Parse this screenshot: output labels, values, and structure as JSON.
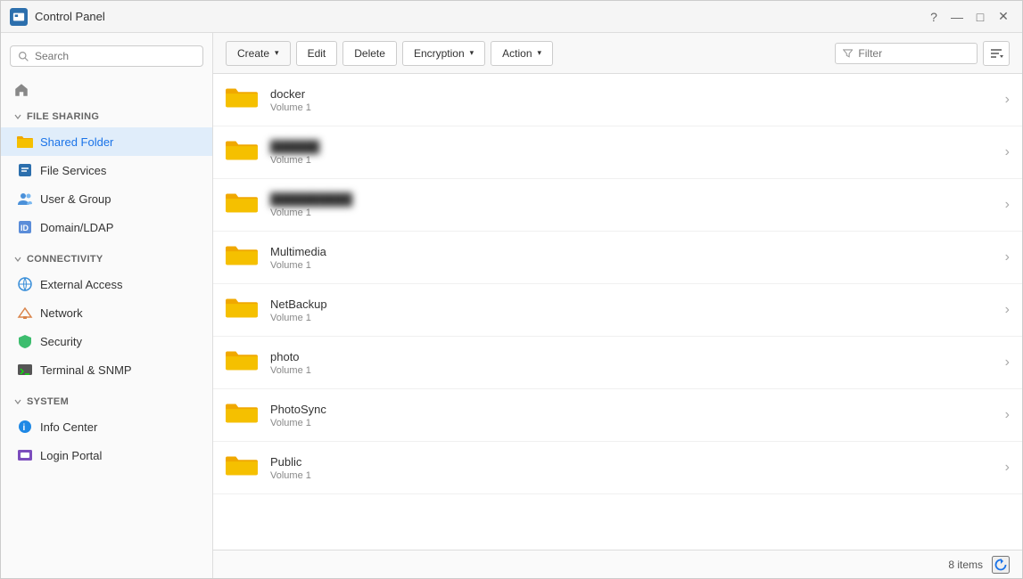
{
  "titlebar": {
    "title": "Control Panel",
    "buttons": [
      "?",
      "—",
      "□",
      "✕"
    ]
  },
  "sidebar": {
    "search_placeholder": "Search",
    "sections": [
      {
        "label": "File Sharing",
        "collapsed": false,
        "items": [
          {
            "id": "shared-folder",
            "label": "Shared Folder",
            "active": true,
            "icon": "folder-orange"
          },
          {
            "id": "file-services",
            "label": "File Services",
            "active": false,
            "icon": "file-services"
          },
          {
            "id": "user-group",
            "label": "User & Group",
            "active": false,
            "icon": "user-group"
          },
          {
            "id": "domain-ldap",
            "label": "Domain/LDAP",
            "active": false,
            "icon": "domain"
          }
        ]
      },
      {
        "label": "Connectivity",
        "collapsed": false,
        "items": [
          {
            "id": "external-access",
            "label": "External Access",
            "active": false,
            "icon": "external-access"
          },
          {
            "id": "network",
            "label": "Network",
            "active": false,
            "icon": "network"
          },
          {
            "id": "security",
            "label": "Security",
            "active": false,
            "icon": "security"
          },
          {
            "id": "terminal-snmp",
            "label": "Terminal & SNMP",
            "active": false,
            "icon": "terminal"
          }
        ]
      },
      {
        "label": "System",
        "collapsed": false,
        "items": [
          {
            "id": "info-center",
            "label": "Info Center",
            "active": false,
            "icon": "info"
          },
          {
            "id": "login-portal",
            "label": "Login Portal",
            "active": false,
            "icon": "login-portal"
          }
        ]
      }
    ]
  },
  "toolbar": {
    "create_label": "Create",
    "edit_label": "Edit",
    "delete_label": "Delete",
    "encryption_label": "Encryption",
    "action_label": "Action",
    "filter_placeholder": "Filter"
  },
  "folders": [
    {
      "name": "docker",
      "sub": "Volume 1",
      "blurred": false
    },
    {
      "name": "██████",
      "sub": "Volume 1",
      "blurred": true
    },
    {
      "name": "██████████",
      "sub": "Volume 1",
      "blurred": true
    },
    {
      "name": "Multimedia",
      "sub": "Volume 1",
      "blurred": false
    },
    {
      "name": "NetBackup",
      "sub": "Volume 1",
      "blurred": false
    },
    {
      "name": "photo",
      "sub": "Volume 1",
      "blurred": false
    },
    {
      "name": "PhotoSync",
      "sub": "Volume 1",
      "blurred": false
    },
    {
      "name": "Public",
      "sub": "Volume 1",
      "blurred": false
    }
  ],
  "statusbar": {
    "items_count": "8 items"
  }
}
